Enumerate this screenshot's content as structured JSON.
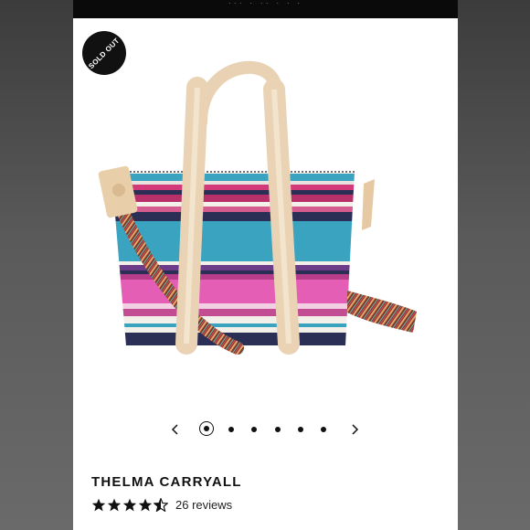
{
  "badge": {
    "text": "SOLD OUT"
  },
  "carousel": {
    "total": 6,
    "active_index": 1
  },
  "product": {
    "name": "THELMA CARRYALL",
    "rating": 4.5,
    "reviews_label": "26 reviews"
  },
  "colors": {
    "accent": "#111111",
    "strap_tan": "#ecd8bc",
    "stripe_blue": "#3aa3c0",
    "stripe_pink": "#e45eb6",
    "stripe_navy": "#2b2f55"
  },
  "icons": {
    "prev": "chevron-left-icon",
    "next": "chevron-right-icon",
    "star": "star-icon"
  }
}
